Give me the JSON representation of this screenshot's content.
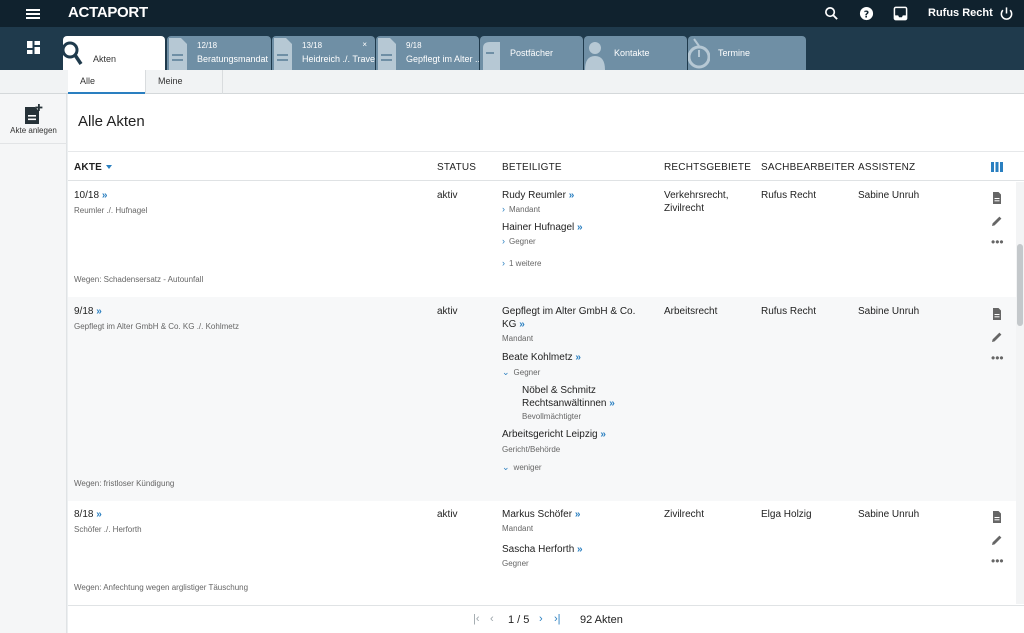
{
  "app": {
    "logo": "ACTAPORT",
    "user": "Rufus Recht"
  },
  "topbar": {
    "icons": [
      "search-icon",
      "help-icon",
      "inbox-icon",
      "power-icon"
    ]
  },
  "tabs": [
    {
      "num": "",
      "label": "Akten",
      "icon": "search-doc-icon",
      "active": true
    },
    {
      "num": "12/18",
      "label": "Beratungsmandat",
      "icon": "document-icon"
    },
    {
      "num": "13/18",
      "label": "Heidreich ./. Trave...",
      "icon": "document-icon",
      "close": "×"
    },
    {
      "num": "9/18",
      "label": "Gepflegt im Alter ...",
      "icon": "document-icon"
    },
    {
      "num": "",
      "label": "Postfächer",
      "icon": "mailbox-icon"
    },
    {
      "num": "",
      "label": "Kontakte",
      "icon": "contact-icon"
    },
    {
      "num": "",
      "label": "Termine",
      "icon": "clock-icon"
    }
  ],
  "subtabs": {
    "all": "Alle",
    "mine": "Meine"
  },
  "sidebar": {
    "add_label": "Akte anlegen"
  },
  "page": {
    "title": "Alle Akten"
  },
  "columns": {
    "akte": "AKTE",
    "status": "STATUS",
    "beteiligte": "BETEILIGTE",
    "rechtsgebiete": "RECHTSGEBIETE",
    "sachbearbeiter": "SACHBEARBEITER",
    "assistenz": "ASSISTENZ"
  },
  "rows": [
    {
      "num": "10/18",
      "title": "Reumler ./. Hufnagel",
      "status": "aktiv",
      "p1": "Rudy Reumler",
      "p1_role": "Mandant",
      "p2": "Hainer Hufnagel",
      "p2_role": "Gegner",
      "more": "1 weitere",
      "rechtsgebiete_1": "Verkehrsrecht,",
      "rechtsgebiete_2": "Zivilrecht",
      "sachbearbeiter": "Rufus Recht",
      "assistenz": "Sabine Unruh",
      "wegen": "Wegen: Schadensersatz - Autounfall"
    },
    {
      "num": "9/18",
      "title": "Gepflegt im Alter GmbH & Co. KG ./. Kohlmetz",
      "status": "aktiv",
      "p1_line1": "Gepflegt im Alter GmbH & Co.",
      "p1_line2": "KG",
      "p1_role": "Mandant",
      "p2": "Beate Kohlmetz",
      "p2_role": "Gegner",
      "p3_line1": "Nöbel & Schmitz",
      "p3_line2": "Rechtsanwältinnen",
      "p3_role": "Bevollmächtigter",
      "p4": "Arbeitsgericht Leipzig",
      "p4_role": "Gericht/Behörde",
      "less": "weniger",
      "rechtsgebiete_1": "Arbeitsrecht",
      "sachbearbeiter": "Rufus Recht",
      "assistenz": "Sabine Unruh",
      "wegen": "Wegen: fristloser Kündigung"
    },
    {
      "num": "8/18",
      "title": "Schöfer ./. Herforth",
      "status": "aktiv",
      "p1": "Markus Schöfer",
      "p1_role": "Mandant",
      "p2": "Sascha Herforth",
      "p2_role": "Gegner",
      "rechtsgebiete_1": "Zivilrecht",
      "sachbearbeiter": "Elga Holzig",
      "assistenz": "Sabine Unruh",
      "wegen": "Wegen: Anfechtung wegen arglistiger Täuschung"
    }
  ],
  "link_glyph": "»",
  "more_glyph": "•••",
  "pager": {
    "first": "|‹",
    "prev": "‹",
    "page": "1 / 5",
    "next": "›",
    "last": "›|",
    "total": "92 Akten"
  }
}
